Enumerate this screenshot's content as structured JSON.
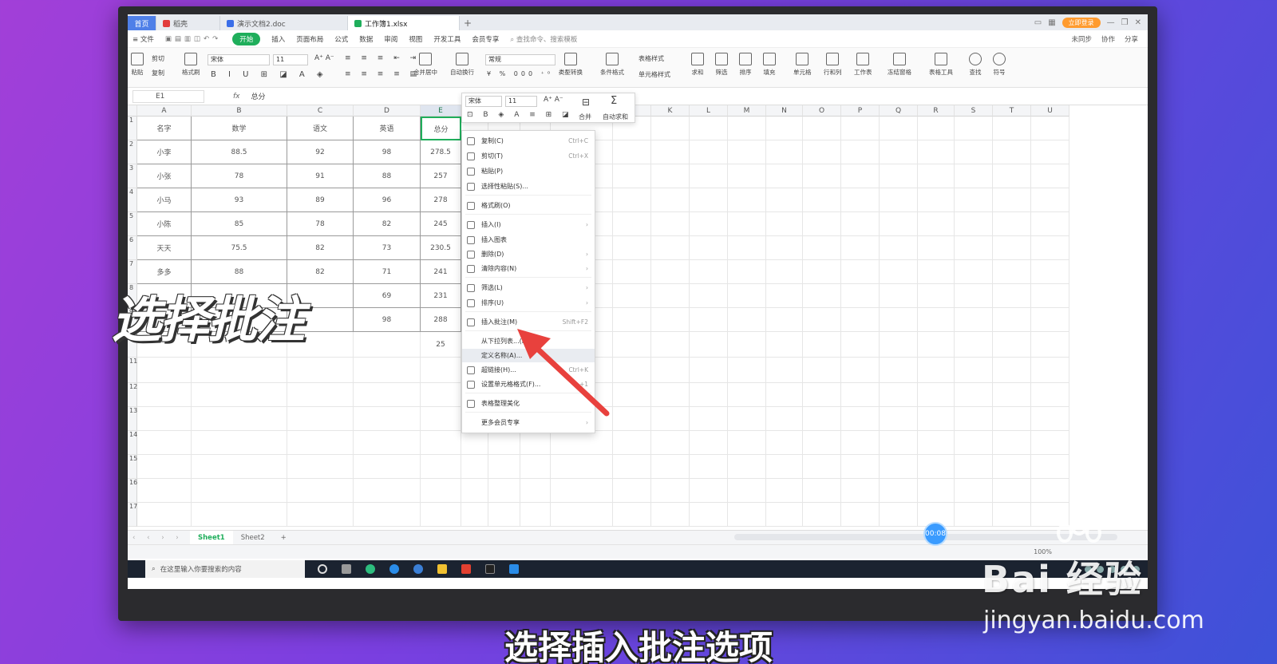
{
  "window": {
    "tabs": [
      {
        "label": "首页"
      },
      {
        "label": "稻壳"
      },
      {
        "label": "演示文档2.doc"
      },
      {
        "label": "工作簿1.xlsx"
      }
    ],
    "add_tab": "+",
    "vip_label": "立即登录"
  },
  "menubar": {
    "file": "≡ 文件",
    "items": [
      "开始",
      "插入",
      "页面布局",
      "公式",
      "数据",
      "审阅",
      "视图",
      "开发工具",
      "会员专享"
    ],
    "search": "查找命令、搜索模板",
    "right": [
      "未同步",
      "协作",
      "分享"
    ]
  },
  "ribbon": {
    "paste": "粘贴",
    "cut": "剪切",
    "copy": "复制",
    "format_painter": "格式刷",
    "font_name": "宋体",
    "font_size": "11",
    "number_format": "常规",
    "merge_center": "合并居中",
    "wrap": "自动换行",
    "type_convert": "类型转换",
    "cond_format": "条件格式",
    "table_style": "表格样式",
    "cell_style": "单元格样式",
    "sum": "求和",
    "filter": "筛选",
    "sort": "排序",
    "fill": "填充",
    "cell": "单元格",
    "row_col": "行和列",
    "worksheet": "工作表",
    "freeze": "冻结窗格",
    "table_tools": "表格工具",
    "find": "查找",
    "symbol": "符号"
  },
  "formula_bar": {
    "name_box": "E1",
    "fx": "fx",
    "value": "总分"
  },
  "columns": [
    "A",
    "B",
    "C",
    "D",
    "E",
    "",
    "",
    "",
    "",
    "J",
    "K",
    "L",
    "M",
    "N",
    "O",
    "P",
    "Q",
    "R",
    "S",
    "T",
    "U"
  ],
  "rows": [
    "1",
    "2",
    "3",
    "4",
    "5",
    "6",
    "7",
    "8",
    "9",
    "10",
    "11",
    "12",
    "13",
    "14",
    "15",
    "16",
    "17"
  ],
  "table": {
    "header": [
      "名字",
      "数学",
      "语文",
      "英语",
      "总分"
    ],
    "data": [
      [
        "小李",
        "88.5",
        "92",
        "98",
        "278.5"
      ],
      [
        "小张",
        "78",
        "91",
        "88",
        "257"
      ],
      [
        "小马",
        "93",
        "89",
        "96",
        "278"
      ],
      [
        "小陈",
        "85",
        "78",
        "82",
        "245"
      ],
      [
        "天天",
        "75.5",
        "82",
        "73",
        "230.5"
      ],
      [
        "多多",
        "88",
        "82",
        "71",
        "241"
      ],
      [
        "",
        "",
        "",
        "69",
        "231"
      ],
      [
        "",
        "",
        "",
        "98",
        "288"
      ]
    ],
    "row10_e": "25"
  },
  "mini_toolbar": {
    "font_name": "宋体",
    "font_size": "11",
    "merge": "合并",
    "autosum": "自动求和"
  },
  "context_menu": {
    "items": [
      {
        "label": "复制(C)",
        "shortcut": "Ctrl+C"
      },
      {
        "label": "剪切(T)",
        "shortcut": "Ctrl+X"
      },
      {
        "label": "粘贴(P)",
        "shortcut": ""
      },
      {
        "label": "选择性粘贴(S)...",
        "shortcut": ""
      },
      {
        "label": "格式刷(O)",
        "shortcut": ""
      },
      {
        "label": "插入(I)",
        "shortcut": "›"
      },
      {
        "label": "插入图表",
        "shortcut": ""
      },
      {
        "label": "删除(D)",
        "shortcut": "›"
      },
      {
        "label": "清除内容(N)",
        "shortcut": "›"
      },
      {
        "label": "筛选(L)",
        "shortcut": "›"
      },
      {
        "label": "排序(U)",
        "shortcut": "›"
      },
      {
        "label": "插入批注(M)",
        "shortcut": "Shift+F2"
      },
      {
        "label": "从下拉列表...(K)...",
        "shortcut": ""
      },
      {
        "label": "定义名称(A)...",
        "shortcut": ""
      },
      {
        "label": "超链接(H)...",
        "shortcut": "Ctrl+K"
      },
      {
        "label": "设置单元格格式(F)...",
        "shortcut": "+1"
      },
      {
        "label": "表格整理美化",
        "shortcut": ""
      },
      {
        "label": "更多会员专享",
        "shortcut": "›"
      }
    ]
  },
  "sheets": [
    "Sheet1",
    "Sheet2"
  ],
  "sheet_add": "+",
  "status": {
    "zoom": "100%"
  },
  "taskbar": {
    "search_placeholder": "在这里输入你要搜索的内容"
  },
  "overlay": {
    "big_caption": "选择批注",
    "subtitle": "选择插入批注选项",
    "timer": "00:08",
    "watermark_logo": "Bai 经验",
    "watermark_url": "jingyan.baidu.com"
  },
  "colors": {
    "wps_green": "#1fae5b",
    "arrow_red": "#e8413d",
    "timer_blue": "#3a9bff"
  }
}
